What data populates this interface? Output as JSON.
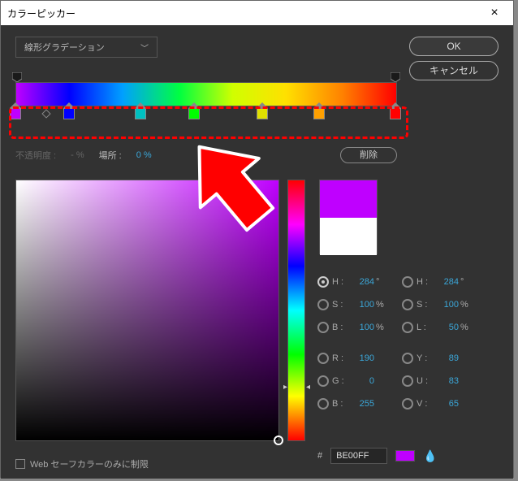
{
  "window": {
    "title": "カラーピッカー"
  },
  "buttons": {
    "ok": "OK",
    "cancel": "キャンセル",
    "delete": "削除"
  },
  "gradient": {
    "type_label": "線形グラデーション",
    "stops": [
      {
        "pos": 0,
        "color": "#bf00ff"
      },
      {
        "pos": 14,
        "color": "#0000ff"
      },
      {
        "pos": 33,
        "color": "#00c0c0"
      },
      {
        "pos": 47,
        "color": "#00ff00"
      },
      {
        "pos": 65,
        "color": "#e0e000"
      },
      {
        "pos": 80,
        "color": "#ffa000"
      },
      {
        "pos": 100,
        "color": "#ff0000"
      }
    ]
  },
  "stop_row": {
    "opacity_label": "不透明度 :",
    "opacity_value": "- %",
    "location_label": "場所 :",
    "location_value": "0 %"
  },
  "hsb": {
    "h": "284",
    "s": "100",
    "b": "100"
  },
  "hsl": {
    "h": "284",
    "s": "100",
    "l": "50"
  },
  "rgb": {
    "r": "190",
    "g": "0",
    "b": "255"
  },
  "yuv": {
    "y": "89",
    "u": "83",
    "v": "65"
  },
  "labels": {
    "H": "H :",
    "S": "S :",
    "B": "B :",
    "L": "L :",
    "R": "R :",
    "G": "G :",
    "Y": "Y :",
    "U": "U :",
    "V": "V :",
    "deg": "°",
    "pct": "%"
  },
  "hex": {
    "prefix": "#",
    "value": "BE00FF"
  },
  "websafe": {
    "label": "Web セーフカラーのみに制限"
  },
  "colors": {
    "accent": "#3ba7d9",
    "current": "#bf00ff"
  }
}
